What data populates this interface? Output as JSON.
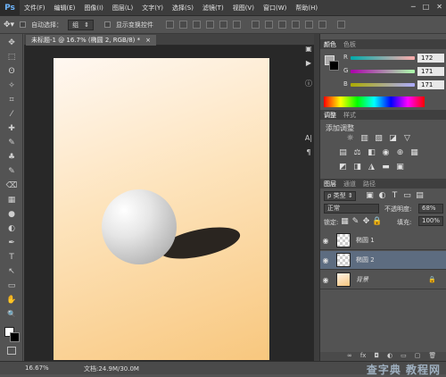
{
  "app": {
    "logo": "Ps"
  },
  "menu": [
    "文件(F)",
    "编辑(E)",
    "图像(I)",
    "图层(L)",
    "文字(Y)",
    "选择(S)",
    "滤镜(T)",
    "视图(V)",
    "窗口(W)",
    "帮助(H)"
  ],
  "window_controls": [
    "─",
    "□",
    "✕"
  ],
  "options": {
    "tool_icon": "move-icon",
    "auto_select_label": "自动选择：",
    "auto_select_value": "组",
    "show_transform_label": "显示变换控件"
  },
  "document": {
    "tab_label": "未标题-1 @ 16.7% (椭圆 2, RGB/8) *",
    "close": "×"
  },
  "toolbox": {
    "icons": [
      "move-icon",
      "marquee-icon",
      "lasso-icon",
      "magic-wand-icon",
      "crop-icon",
      "eyedropper-icon",
      "healing-icon",
      "brush-icon",
      "stamp-icon",
      "history-brush-icon",
      "eraser-icon",
      "gradient-icon",
      "blur-icon",
      "dodge-icon",
      "pen-icon",
      "type-icon",
      "path-select-icon",
      "shape-icon",
      "hand-icon",
      "zoom-icon"
    ],
    "glyphs": [
      "✥",
      "⬚",
      "ʘ",
      "✧",
      "⌗",
      "⁄",
      "✚",
      "✎",
      "♣",
      "✎",
      "⌫",
      "▦",
      "●",
      "◐",
      "✒",
      "T",
      "↖",
      "▭",
      "✋",
      "🔍"
    ],
    "foreground_color": "#ffffff",
    "background_color": "#000000"
  },
  "status": {
    "zoom": "16.67%",
    "doc_size": "文档:24.9M/30.0M",
    "watermark": "查字典 教程网"
  },
  "color_panel": {
    "tabs": [
      "颜色",
      "色板"
    ],
    "channels": [
      {
        "label": "R",
        "value": "172"
      },
      {
        "label": "G",
        "value": "171"
      },
      {
        "label": "B",
        "value": "171"
      }
    ]
  },
  "adjustments_panel": {
    "tabs": [
      "调整",
      "样式"
    ],
    "title": "添加调整"
  },
  "layers_panel": {
    "tabs": [
      "图层",
      "通道",
      "路径"
    ],
    "filter_kind": "类型",
    "blend_mode": "正常",
    "opacity_label": "不透明度:",
    "opacity_value": "68%",
    "lock_label": "锁定:",
    "fill_label": "填充:",
    "fill_value": "100%",
    "layers": [
      {
        "name": "椭圆 1",
        "visible_icon": "eye-icon",
        "selected": false
      },
      {
        "name": "椭圆 2",
        "visible_icon": "eye-icon",
        "selected": true
      },
      {
        "name": "背景",
        "visible_icon": "eye-icon",
        "selected": false,
        "locked": true
      }
    ]
  },
  "colors": {
    "accent": "#3f5a7a",
    "canvas_top": "#fff8f2",
    "canvas_bottom": "#f8c77e"
  }
}
